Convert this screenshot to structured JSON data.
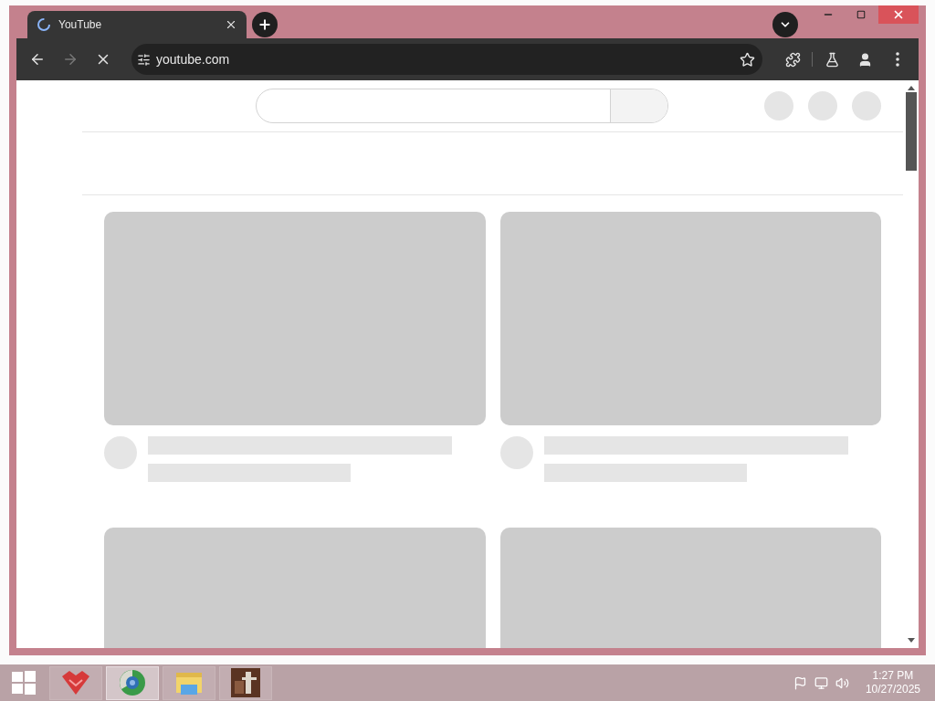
{
  "browser": {
    "tab": {
      "title": "YouTube",
      "loading": true
    },
    "forward": {
      "disabled": true
    },
    "address": "youtube.com"
  },
  "taskbar": {
    "apps": [
      {
        "kind": "tools",
        "selected": false
      },
      {
        "kind": "browser",
        "selected": true
      },
      {
        "kind": "folder",
        "selected": false
      },
      {
        "kind": "photo",
        "selected": false
      }
    ],
    "time": "1:27 PM",
    "date": "10/27/2025"
  }
}
